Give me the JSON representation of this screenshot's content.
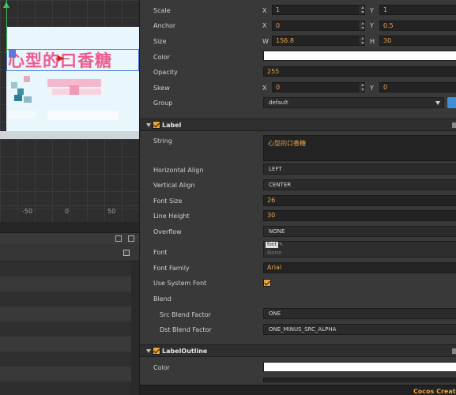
{
  "scene": {
    "label_text": "心型的口香糖",
    "ruler": [
      "-50",
      "0",
      "50"
    ]
  },
  "inspector": {
    "node": {
      "scale": {
        "label": "Scale",
        "x_label": "X",
        "x": "1",
        "y_label": "Y",
        "y": "1"
      },
      "anchor": {
        "label": "Anchor",
        "x_label": "X",
        "x": "0",
        "y_label": "Y",
        "y": "0.5"
      },
      "size": {
        "label": "Size",
        "w_label": "W",
        "w": "156.8",
        "h_label": "H",
        "h": "30"
      },
      "color": {
        "label": "Color",
        "value": "#ffffff"
      },
      "opacity": {
        "label": "Opacity",
        "value": "255"
      },
      "skew": {
        "label": "Skew",
        "x_label": "X",
        "x": "0",
        "y_label": "Y",
        "y": "0"
      },
      "group": {
        "label": "Group",
        "value": "default"
      }
    },
    "label_component": {
      "title": "Label",
      "enabled": true,
      "string": {
        "label": "String",
        "value": "心型的口香糖"
      },
      "horizontal_align": {
        "label": "Horizontal Align",
        "value": "LEFT"
      },
      "vertical_align": {
        "label": "Vertical Align",
        "value": "CENTER"
      },
      "font_size": {
        "label": "Font Size",
        "value": "26"
      },
      "line_height": {
        "label": "Line Height",
        "value": "30"
      },
      "overflow": {
        "label": "Overflow",
        "value": "NONE"
      },
      "font": {
        "label": "Font",
        "tag": "font",
        "value": "None"
      },
      "font_family": {
        "label": "Font Family",
        "value": "Arial"
      },
      "use_system_font": {
        "label": "Use System Font",
        "checked": true
      },
      "blend": {
        "label": "Blend"
      },
      "src_blend_factor": {
        "label": "Src Blend Factor",
        "value": "ONE"
      },
      "dst_blend_factor": {
        "label": "Dst Blend Factor",
        "value": "ONE_MINUS_SRC_ALPHA"
      }
    },
    "label_outline": {
      "title": "LabelOutline",
      "enabled": true,
      "color": {
        "label": "Color",
        "value": "#ffffff"
      }
    }
  },
  "footer": {
    "brand": "Cocos Creator"
  },
  "colors": {
    "accent_orange": "#f0a236",
    "value_orange": "#e9a24a",
    "label_pink": "#ee5a8f"
  }
}
